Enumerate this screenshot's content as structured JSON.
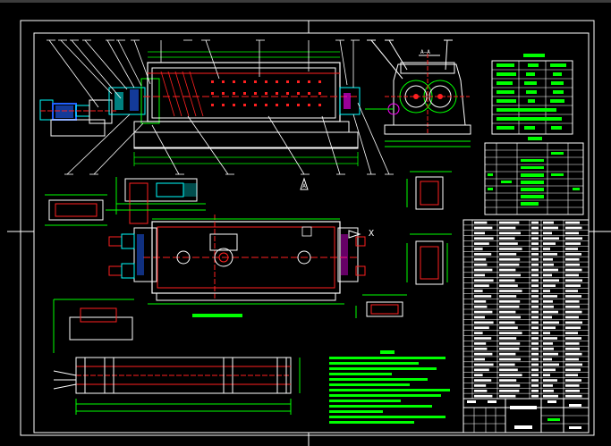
{
  "drawing": {
    "background": "#000000",
    "colors": {
      "frame": "#ffffff",
      "red": "#ff2020",
      "green": "#00ff00",
      "cyan": "#00ffff",
      "blue": "#2060ff",
      "yellow": "#ffff00",
      "magenta": "#ff00ff"
    },
    "section_marker": "X",
    "section_arrow": "A",
    "view_label_top": "A—A",
    "view_label_plan": "",
    "notes_heading": ""
  },
  "parts_table": {
    "rows": 34,
    "cols": 6
  },
  "title_block": {
    "drawing_title": "",
    "scale": "",
    "sheet": ""
  }
}
